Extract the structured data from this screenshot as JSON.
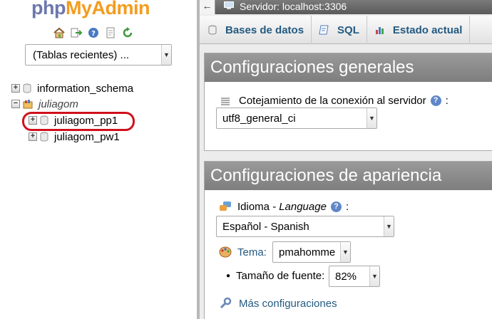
{
  "nav": {
    "logo": {
      "php": "php",
      "my": "My",
      "admin": "Admin"
    },
    "recent_tables": "(Tablas recientes) ...",
    "tree": [
      {
        "label": "information_schema",
        "expander": "+"
      },
      {
        "label": "juliagom",
        "expander": "−"
      },
      {
        "label": "juliagom_pp1",
        "expander": "+"
      },
      {
        "label": "juliagom_pw1",
        "expander": "+"
      }
    ]
  },
  "server_bar": {
    "back": "←",
    "text": "Servidor: localhost:3306"
  },
  "tabs": [
    {
      "label": "Bases de datos",
      "icon": "database-icon"
    },
    {
      "label": "SQL",
      "icon": "sql-icon"
    },
    {
      "label": "Estado actual",
      "icon": "status-icon"
    }
  ],
  "general": {
    "title": "Configuraciones generales",
    "collation_label": "Cotejamiento de la conexión al servidor",
    "collation_colon": ":",
    "collation_value": "utf8_general_ci"
  },
  "appearance": {
    "title": "Configuraciones de apariencia",
    "language_label": "Idioma - ",
    "language_label_en": "Language",
    "language_colon": ":",
    "language_value": "Español - Spanish",
    "theme_label": "Tema:",
    "theme_value": "pmahomme",
    "fontsize_label": "Tamaño de fuente:",
    "fontsize_value": "82%",
    "more_settings": "Más configuraciones"
  },
  "colors": {
    "link": "#235a81",
    "highlight": "#d0101c",
    "group_header": "#8a8a8a"
  }
}
